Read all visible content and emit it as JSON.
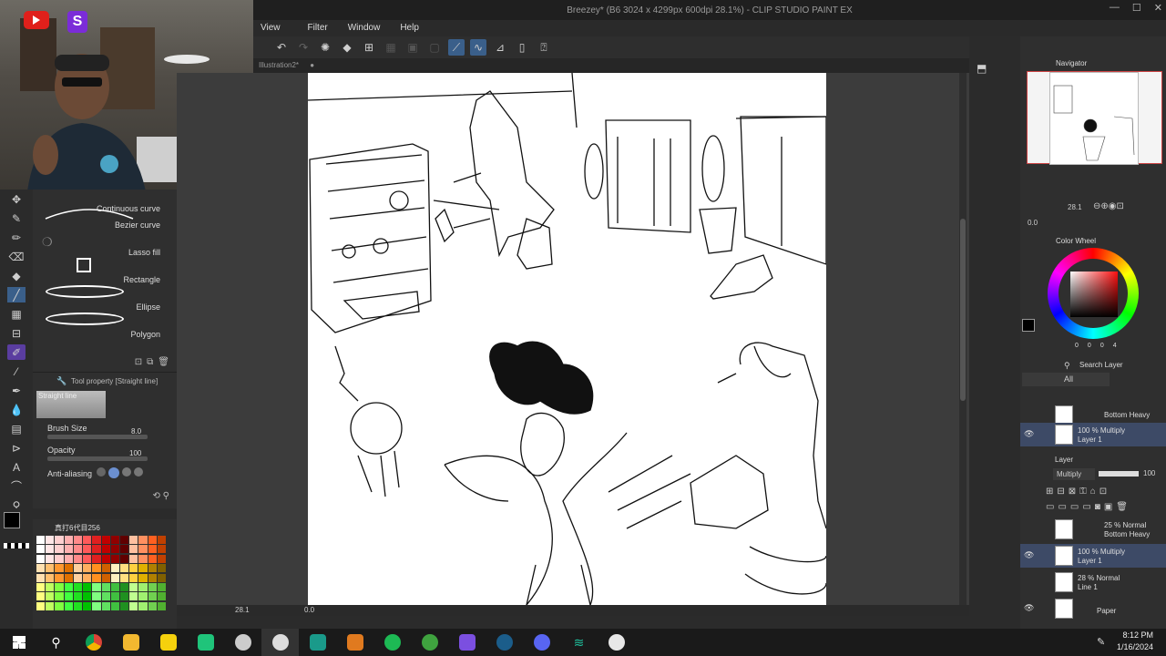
{
  "app": {
    "window_title": "Breezey* (B6 3024 x 4299px 600dpi 28.1%)  - CLIP STUDIO PAINT EX",
    "menu": [
      "View",
      "Filter",
      "Window",
      "Help"
    ],
    "document_tab": "Illustration2*",
    "win_controls": [
      "—",
      "☐",
      "✕"
    ]
  },
  "webcam": {
    "youtube_badge": "youtube",
    "s_badge": "S"
  },
  "subtool": {
    "items": [
      "Continuous curve",
      "Bezier curve",
      "Lasso fill",
      "Rectangle",
      "Ellipse",
      "Polygon"
    ]
  },
  "tool_property": {
    "header": "Tool property [Straight line]",
    "name": "Straight line",
    "brush_size_label": "Brush Size",
    "brush_size_value": "8.0",
    "opacity_label": "Opacity",
    "opacity_value": "100",
    "antialias_label": "Anti-aliasing"
  },
  "palette": {
    "name": "真打6代目256"
  },
  "statusbar": {
    "zoom": "28.1",
    "angle": "0.0"
  },
  "navigator": {
    "title": "Navigator",
    "zoom": "28.1",
    "angle": "0.0"
  },
  "color_wheel": {
    "title": "Color Wheel",
    "values": [
      "0",
      "0",
      "0",
      "4"
    ]
  },
  "layers": {
    "search_label": "Search Layer",
    "filter": "All",
    "panel_label": "Layer",
    "blend_mode": "Multiply",
    "opacity": "100",
    "top_list": [
      {
        "line1": "Bottom Heavy",
        "line2": ""
      },
      {
        "line1": "100 % Multiply",
        "line2": "Layer 1"
      }
    ],
    "list": [
      {
        "line1": "25 % Normal",
        "line2": "Bottom Heavy"
      },
      {
        "line1": "100 % Multiply",
        "line2": "Layer 1"
      },
      {
        "line1": "28 % Normal",
        "line2": "Line 1"
      },
      {
        "line1": "Paper",
        "line2": ""
      }
    ]
  },
  "clock": {
    "time": "8:12 PM",
    "date": "1/16/2024"
  },
  "colors": {
    "taskbar": "#1a1a1a",
    "panel": "#2f2f2f",
    "accent": "#3a5f8a",
    "active_tool": "#5a3da0"
  }
}
